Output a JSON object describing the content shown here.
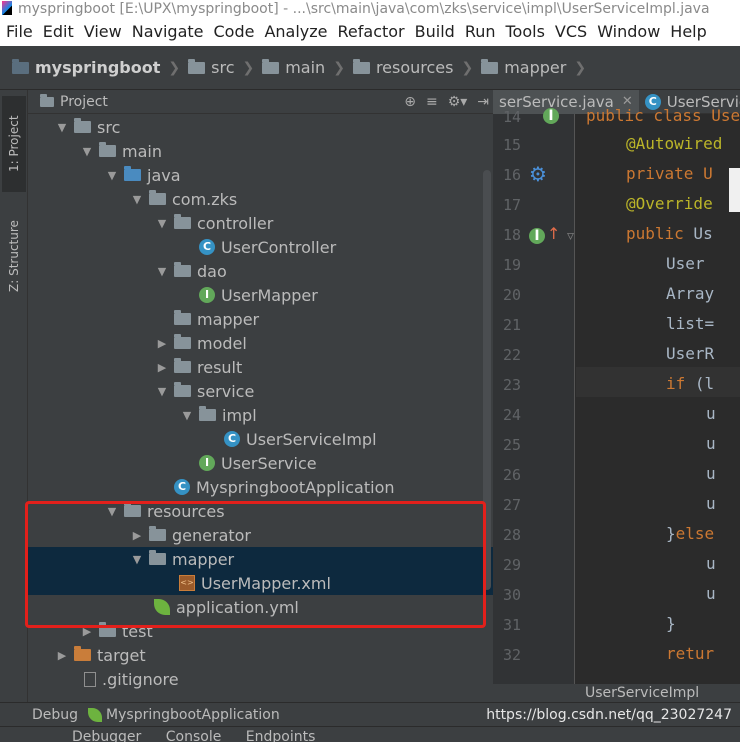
{
  "titlebar": {
    "text": "myspringboot [E:\\UPX\\myspringboot] - ...\\src\\main\\java\\com\\zks\\service\\impl\\UserServiceImpl.java"
  },
  "menubar": {
    "items": [
      "File",
      "Edit",
      "View",
      "Navigate",
      "Code",
      "Analyze",
      "Refactor",
      "Build",
      "Run",
      "Tools",
      "VCS",
      "Window",
      "Help"
    ]
  },
  "breadcrumbs": [
    "myspringboot",
    "src",
    "main",
    "resources",
    "mapper"
  ],
  "left_strip": {
    "project_tab": "1: Project",
    "structure_tab": "Z: Structure"
  },
  "project_panel": {
    "title": "Project",
    "tree": [
      {
        "label": "src"
      },
      {
        "label": "main"
      },
      {
        "label": "java"
      },
      {
        "label": "com.zks"
      },
      {
        "label": "controller"
      },
      {
        "label": "UserController"
      },
      {
        "label": "dao"
      },
      {
        "label": "UserMapper"
      },
      {
        "label": "mapper"
      },
      {
        "label": "model"
      },
      {
        "label": "result"
      },
      {
        "label": "service"
      },
      {
        "label": "impl"
      },
      {
        "label": "UserServiceImpl"
      },
      {
        "label": "UserService"
      },
      {
        "label": "MyspringbootApplication"
      },
      {
        "label": "resources"
      },
      {
        "label": "generator"
      },
      {
        "label": "mapper"
      },
      {
        "label": "UserMapper.xml"
      },
      {
        "label": "application.yml"
      },
      {
        "label": "test"
      },
      {
        "label": "target"
      },
      {
        "label": ".gitignore"
      }
    ]
  },
  "editor": {
    "tabs": [
      "serService.java",
      "UserService"
    ],
    "line_numbers": [
      "14",
      "15",
      "16",
      "17",
      "18",
      "19",
      "20",
      "21",
      "22",
      "23",
      "24",
      "25",
      "26",
      "27",
      "28",
      "29",
      "30",
      "31",
      "32"
    ],
    "lines": {
      "l14": "public class Use",
      "l15": "@Autowired",
      "l16": "private U",
      "l17": "@Override",
      "l18a": "public",
      "l18b": " Us",
      "l19": "User",
      "l20": "Array",
      "l21": "list=",
      "l22": "UserR",
      "l23a": "if",
      "l23b": " (l",
      "l24": "u",
      "l25": "u",
      "l26": "u",
      "l27": "u",
      "l28a": "}",
      "l28b": "else",
      "l29": "u",
      "l30": "u",
      "l31": "}",
      "l32": "retur"
    },
    "breadcrumb": "UserServiceImpl"
  },
  "debugbar": {
    "label": "Debug",
    "config": "MyspringbootApplication"
  },
  "bottom_tools": [
    "Debugger",
    "Console",
    "Endpoints"
  ],
  "watermark": "https://blog.csdn.net/qq_23027247"
}
